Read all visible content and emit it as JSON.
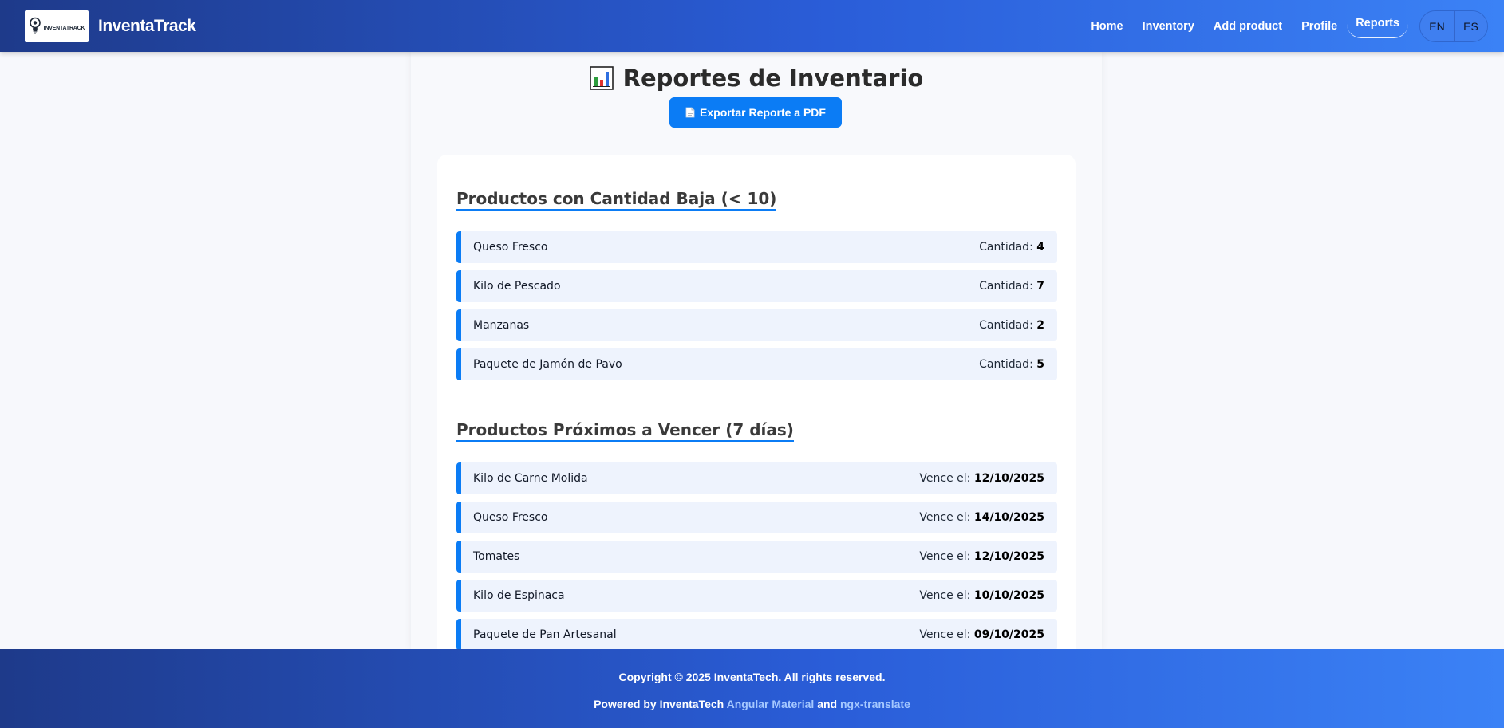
{
  "header": {
    "logo_text": "INVENTATRACK",
    "brand": "InventaTrack",
    "nav": [
      {
        "label": "Home",
        "active": false
      },
      {
        "label": "Inventory",
        "active": false
      },
      {
        "label": "Add product",
        "active": false
      },
      {
        "label": "Profile",
        "active": false
      },
      {
        "label": "Reports",
        "active": true
      }
    ],
    "languages": [
      "EN",
      "ES"
    ]
  },
  "page": {
    "title": "Reportes de Inventario",
    "export_label": "Exportar Reporte a PDF"
  },
  "low_stock": {
    "title": "Productos con Cantidad Baja (< 10)",
    "label": "Cantidad:",
    "items": [
      {
        "name": "Queso Fresco",
        "value": "4"
      },
      {
        "name": "Kilo de Pescado",
        "value": "7"
      },
      {
        "name": "Manzanas",
        "value": "2"
      },
      {
        "name": "Paquete de Jamón de Pavo",
        "value": "5"
      }
    ]
  },
  "expiring": {
    "title": "Productos Próximos a Vencer (7 días)",
    "label": "Vence el:",
    "items": [
      {
        "name": "Kilo de Carne Molida",
        "value": "12/10/2025"
      },
      {
        "name": "Queso Fresco",
        "value": "14/10/2025"
      },
      {
        "name": "Tomates",
        "value": "12/10/2025"
      },
      {
        "name": "Kilo de Espinaca",
        "value": "10/10/2025"
      },
      {
        "name": "Paquete de Pan Artesanal",
        "value": "09/10/2025"
      }
    ]
  },
  "footer": {
    "copyright": "Copyright © 2025 InventaTech. All rights reserved.",
    "powered_prefix": "Powered by InventaTech",
    "link1": "Angular Material",
    "and": "and",
    "link2": "ngx-translate"
  },
  "colors": {
    "accent": "#0b7cf5",
    "header_start": "#1e3a8a",
    "header_end": "#3b82f6",
    "row_bg": "#eef3fd"
  }
}
